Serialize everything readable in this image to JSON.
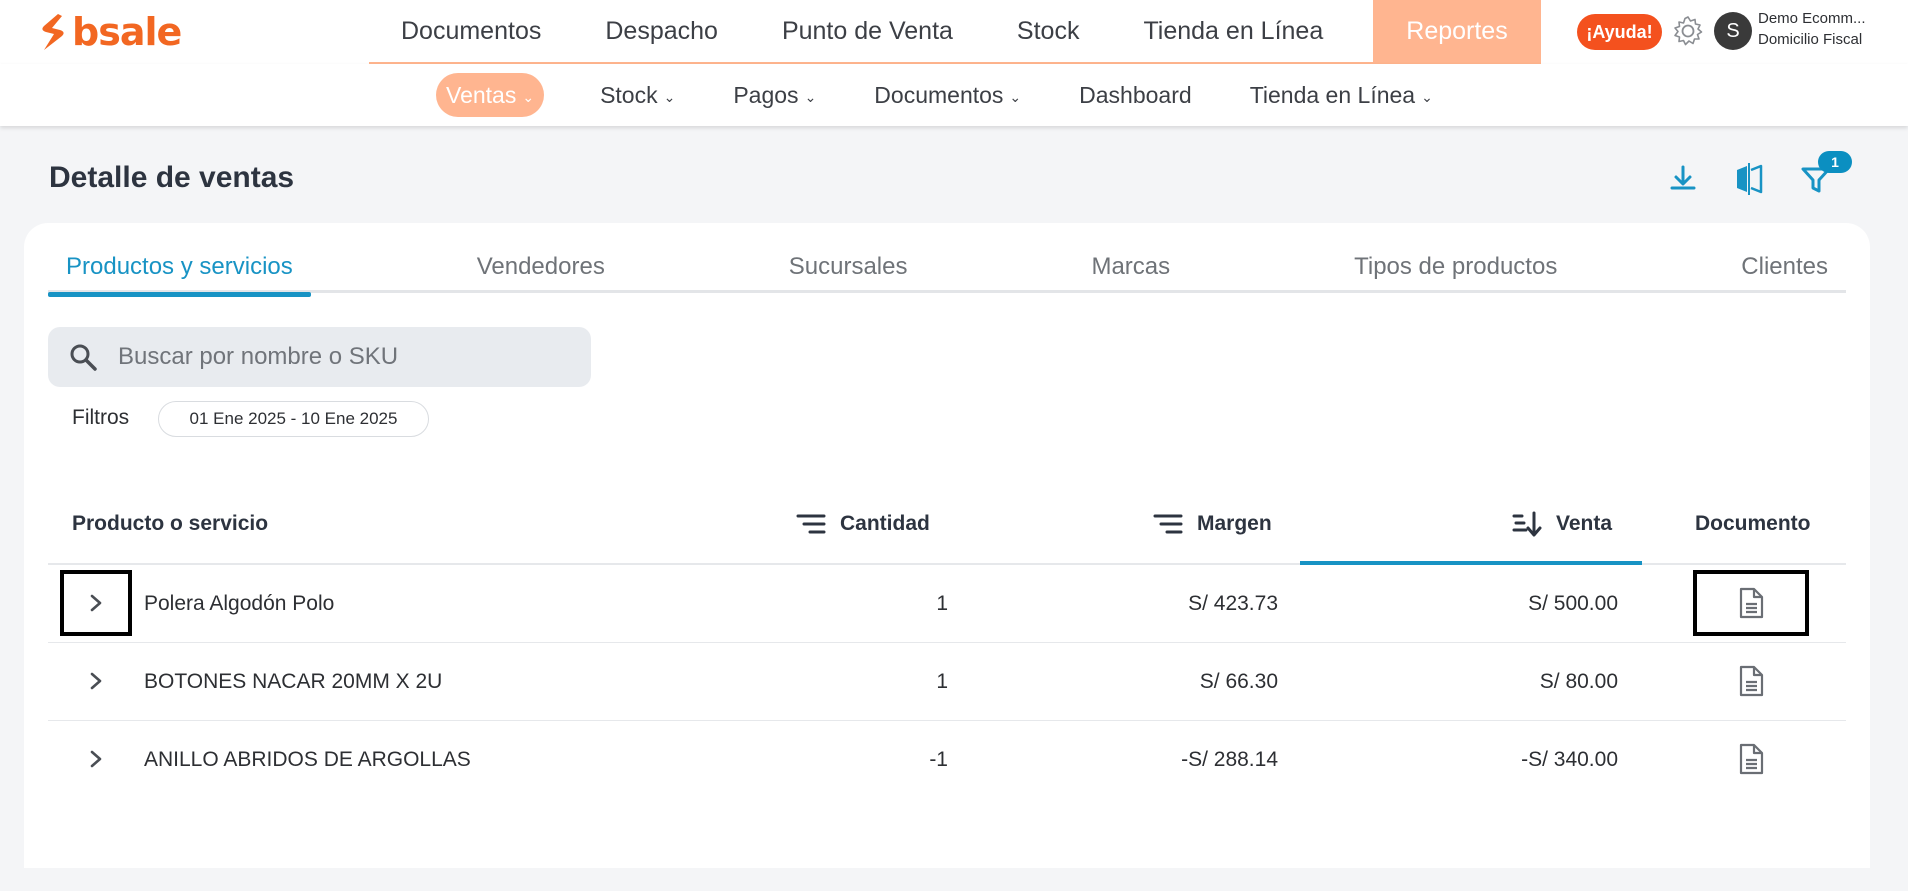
{
  "brand": {
    "name": "bsale",
    "color": "#f26722"
  },
  "main_nav": {
    "items": [
      "Documentos",
      "Despacho",
      "Punto de Venta",
      "Stock",
      "Tienda en Línea"
    ],
    "active": "Reportes"
  },
  "header": {
    "help_label": "¡Ayuda!",
    "avatar_initial": "S",
    "user_name": "Demo Ecomm...",
    "user_subtitle": "Domicilio Fiscal"
  },
  "sub_nav": {
    "items": [
      {
        "label": "Ventas",
        "dropdown": true,
        "active": true
      },
      {
        "label": "Stock",
        "dropdown": true
      },
      {
        "label": "Pagos",
        "dropdown": true
      },
      {
        "label": "Documentos",
        "dropdown": true
      },
      {
        "label": "Dashboard",
        "dropdown": false
      },
      {
        "label": "Tienda en Línea",
        "dropdown": true
      }
    ]
  },
  "page": {
    "title": "Detalle de ventas",
    "filter_count": "1"
  },
  "tabs": [
    "Productos y servicios",
    "Vendedores",
    "Sucursales",
    "Marcas",
    "Tipos de productos",
    "Clientes"
  ],
  "search": {
    "placeholder": "Buscar por nombre o SKU"
  },
  "filters": {
    "label": "Filtros",
    "date_range": "01 Ene 2025 - 10 Ene 2025"
  },
  "table": {
    "columns": {
      "product": "Producto o servicio",
      "quantity": "Cantidad",
      "margin": "Margen",
      "sale": "Venta",
      "document": "Documento"
    },
    "rows": [
      {
        "product": "Polera Algodón Polo",
        "quantity": "1",
        "margin": "S/ 423.73",
        "sale": "S/ 500.00"
      },
      {
        "product": "BOTONES NACAR 20MM X 2U",
        "quantity": "1",
        "margin": "S/ 66.30",
        "sale": "S/ 80.00"
      },
      {
        "product": "ANILLO ABRIDOS DE ARGOLLAS",
        "quantity": "-1",
        "margin": "-S/ 288.14",
        "sale": "-S/ 340.00"
      }
    ]
  },
  "colors": {
    "accent": "#1893c4",
    "orange": "#f26722",
    "orange_light": "#ffb590",
    "help": "#f4511e"
  }
}
